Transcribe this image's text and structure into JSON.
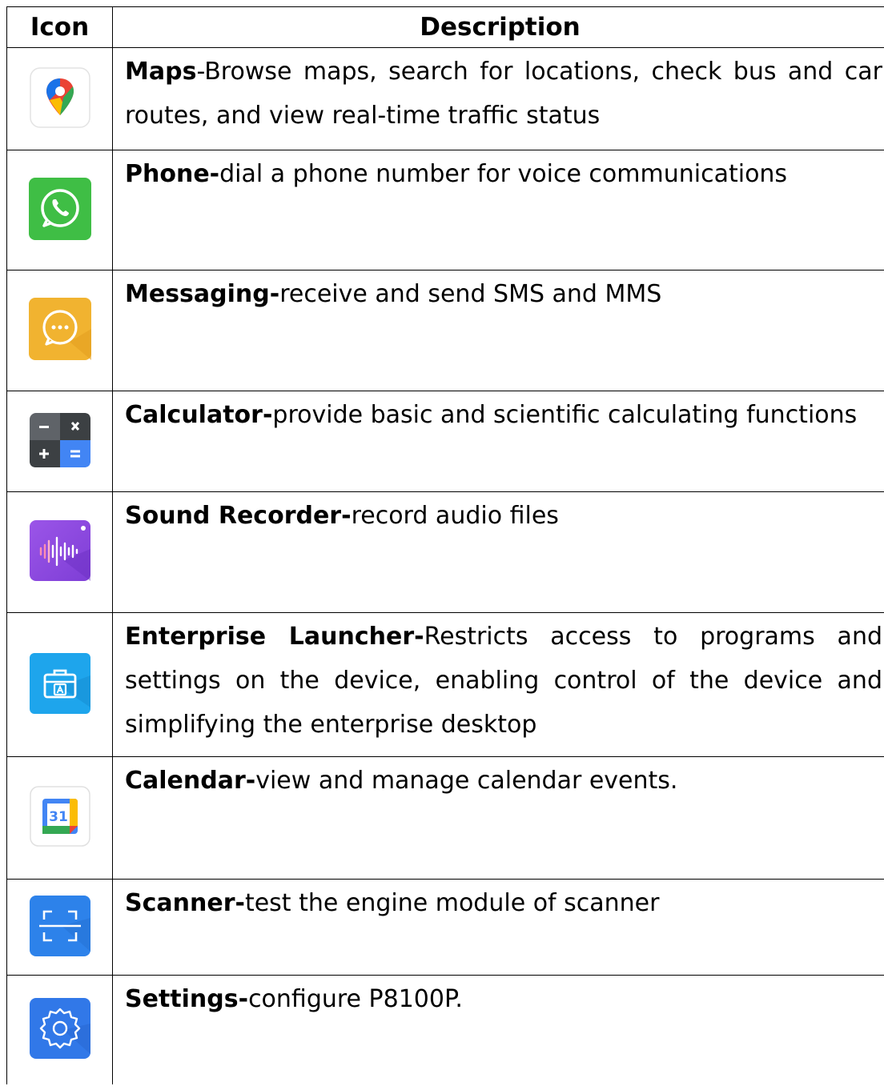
{
  "table": {
    "headers": {
      "icon": "Icon",
      "description": "Description"
    },
    "rows": [
      {
        "icon": "google-maps-icon",
        "name": "Maps",
        "sep": "-",
        "text": "Browse maps, search for locations, check bus and car routes, and view real-time traffic status"
      },
      {
        "icon": "phone-icon",
        "name": "Phone-",
        "sep": "",
        "text": "dial a phone number for voice communications"
      },
      {
        "icon": "messaging-icon",
        "name": "Messaging-",
        "sep": "",
        "text": "receive and send SMS and MMS"
      },
      {
        "icon": "calculator-icon",
        "name": "Calculator-",
        "sep": "",
        "text": "provide basic and scientific calculating functions"
      },
      {
        "icon": "sound-recorder-icon",
        "name": "Sound Recorder-",
        "sep": "",
        "text": "record audio files"
      },
      {
        "icon": "enterprise-launcher-icon",
        "name": "Enterprise Launcher-",
        "sep": "",
        "text": "Restricts access to programs and settings on the device, enabling control of the device and simplifying the enterprise desktop"
      },
      {
        "icon": "calendar-icon",
        "name": "Calendar-",
        "sep": "",
        "text": "view and manage calendar events.",
        "icon_text": "31"
      },
      {
        "icon": "scanner-icon",
        "name": "Scanner-",
        "sep": "",
        "text": "test the engine module of scanner"
      },
      {
        "icon": "settings-icon",
        "name": "Settings-",
        "sep": "",
        "text": "configure P8100P."
      }
    ]
  }
}
